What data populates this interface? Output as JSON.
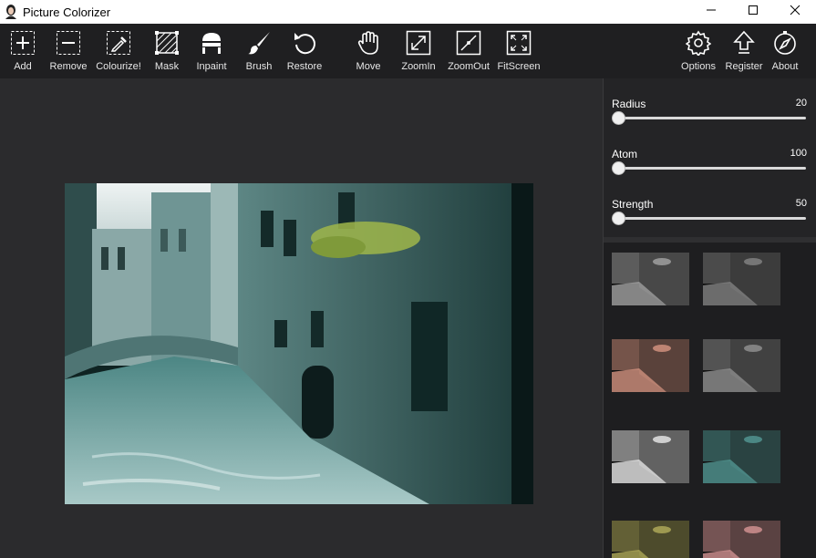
{
  "window": {
    "title": "Picture Colorizer",
    "minimize_glyph": "—",
    "maximize_glyph": "☐",
    "close_glyph": "✕"
  },
  "toolbar": {
    "add": "Add",
    "remove": "Remove",
    "colourize": "Colourize!",
    "mask": "Mask",
    "inpaint": "Inpaint",
    "brush": "Brush",
    "restore": "Restore",
    "move": "Move",
    "zoomin": "ZoomIn",
    "zoomout": "ZoomOut",
    "fitscreen": "FitScreen",
    "options": "Options",
    "register": "Register",
    "about": "About"
  },
  "sliders": [
    {
      "label": "Radius",
      "value": "20"
    },
    {
      "label": "Atom",
      "value": "100"
    },
    {
      "label": "Strength",
      "value": "50"
    }
  ],
  "presets": [
    {
      "name": "preset-1",
      "tint": "#9a9a9a"
    },
    {
      "name": "preset-2",
      "tint": "#7c7c7c"
    },
    {
      "name": "preset-3",
      "tint": "#c98c7a"
    },
    {
      "name": "preset-4",
      "tint": "#8a8a8a"
    },
    {
      "name": "preset-5",
      "tint": "#dcdcdc"
    },
    {
      "name": "preset-6",
      "tint": "#4f8f8c"
    },
    {
      "name": "preset-7",
      "tint": "#a7a255"
    },
    {
      "name": "preset-8",
      "tint": "#c98c8c"
    }
  ],
  "colors": {
    "toolbar_bg": "#1f1f21",
    "canvas_bg": "#2b2b2d",
    "panel_bg": "#1e1e20",
    "photo_tint": "#2e5a58"
  }
}
